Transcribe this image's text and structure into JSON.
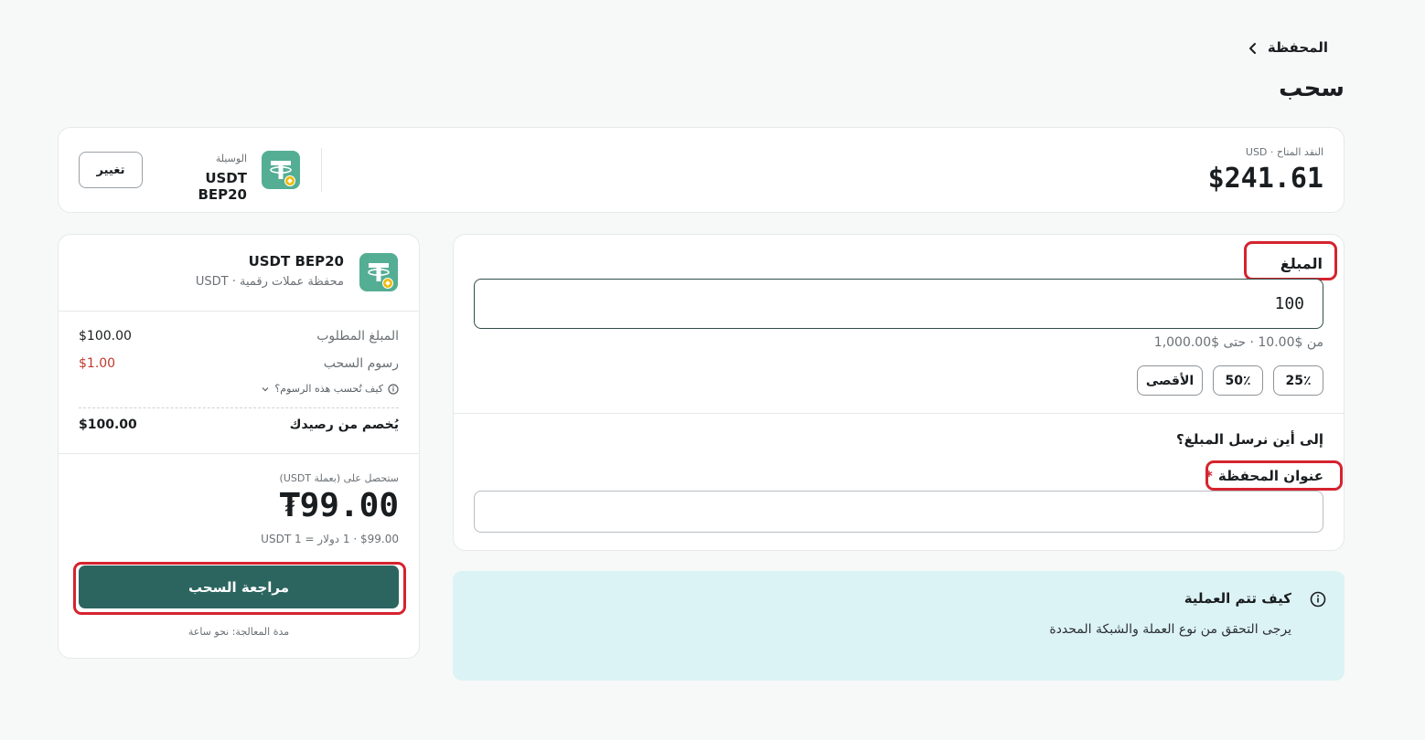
{
  "breadcrumb": {
    "label": "المحفظة"
  },
  "page_title": "سحب",
  "balance": {
    "label": "النقد المتاح · USD",
    "amount": "$241.61"
  },
  "method": {
    "label": "الوسيلة",
    "name": "USDT BEP20",
    "change_label": "تغيير"
  },
  "amount_section": {
    "label": "المبلغ",
    "value": "100",
    "range_hint": "من $10.00 · حتى $1,000.00",
    "quick": [
      "25٪",
      "50٪",
      "الأقصى"
    ]
  },
  "destination": {
    "question": "إلى أين نرسل المبلغ؟",
    "wallet_label": "عنوان المحفظة",
    "required_mark": "*",
    "wallet_value": ""
  },
  "info_box": {
    "title": "كيف تتم العملية",
    "text": "يرجى التحقق من نوع العملة والشبكة المحددة"
  },
  "summary": {
    "coin_name": "USDT BEP20",
    "coin_sub": "محفظة عملات رقمية · USDT",
    "rows": [
      {
        "label": "المبلغ المطلوب",
        "value": "$100.00"
      },
      {
        "label": "رسوم السحب",
        "value": "$1.00"
      }
    ],
    "fee_help": "كيف تُحسب هذه الرسوم؟",
    "deduct_label": "يُخصم من رصيدك",
    "deduct_value": "$100.00",
    "receive_label": "ستحصل على (بعملة USDT)",
    "receive_amount": "₮99.00",
    "rate": "$99.00 · 1 دولار = 1 USDT",
    "review_button": "مراجعة السحب",
    "processing": "مدة المعالجة: نحو ساعة"
  },
  "colors": {
    "accent": "#2c6560",
    "fee_red": "#c0392b",
    "highlight": "#d5232f",
    "info_bg": "#dcf3f5",
    "coin_green": "#54ae94"
  },
  "icons": {
    "breadcrumb": "chevron-left-icon",
    "coin": "tether-icon",
    "info": "info-icon",
    "chevron": "chevron-down-icon"
  }
}
